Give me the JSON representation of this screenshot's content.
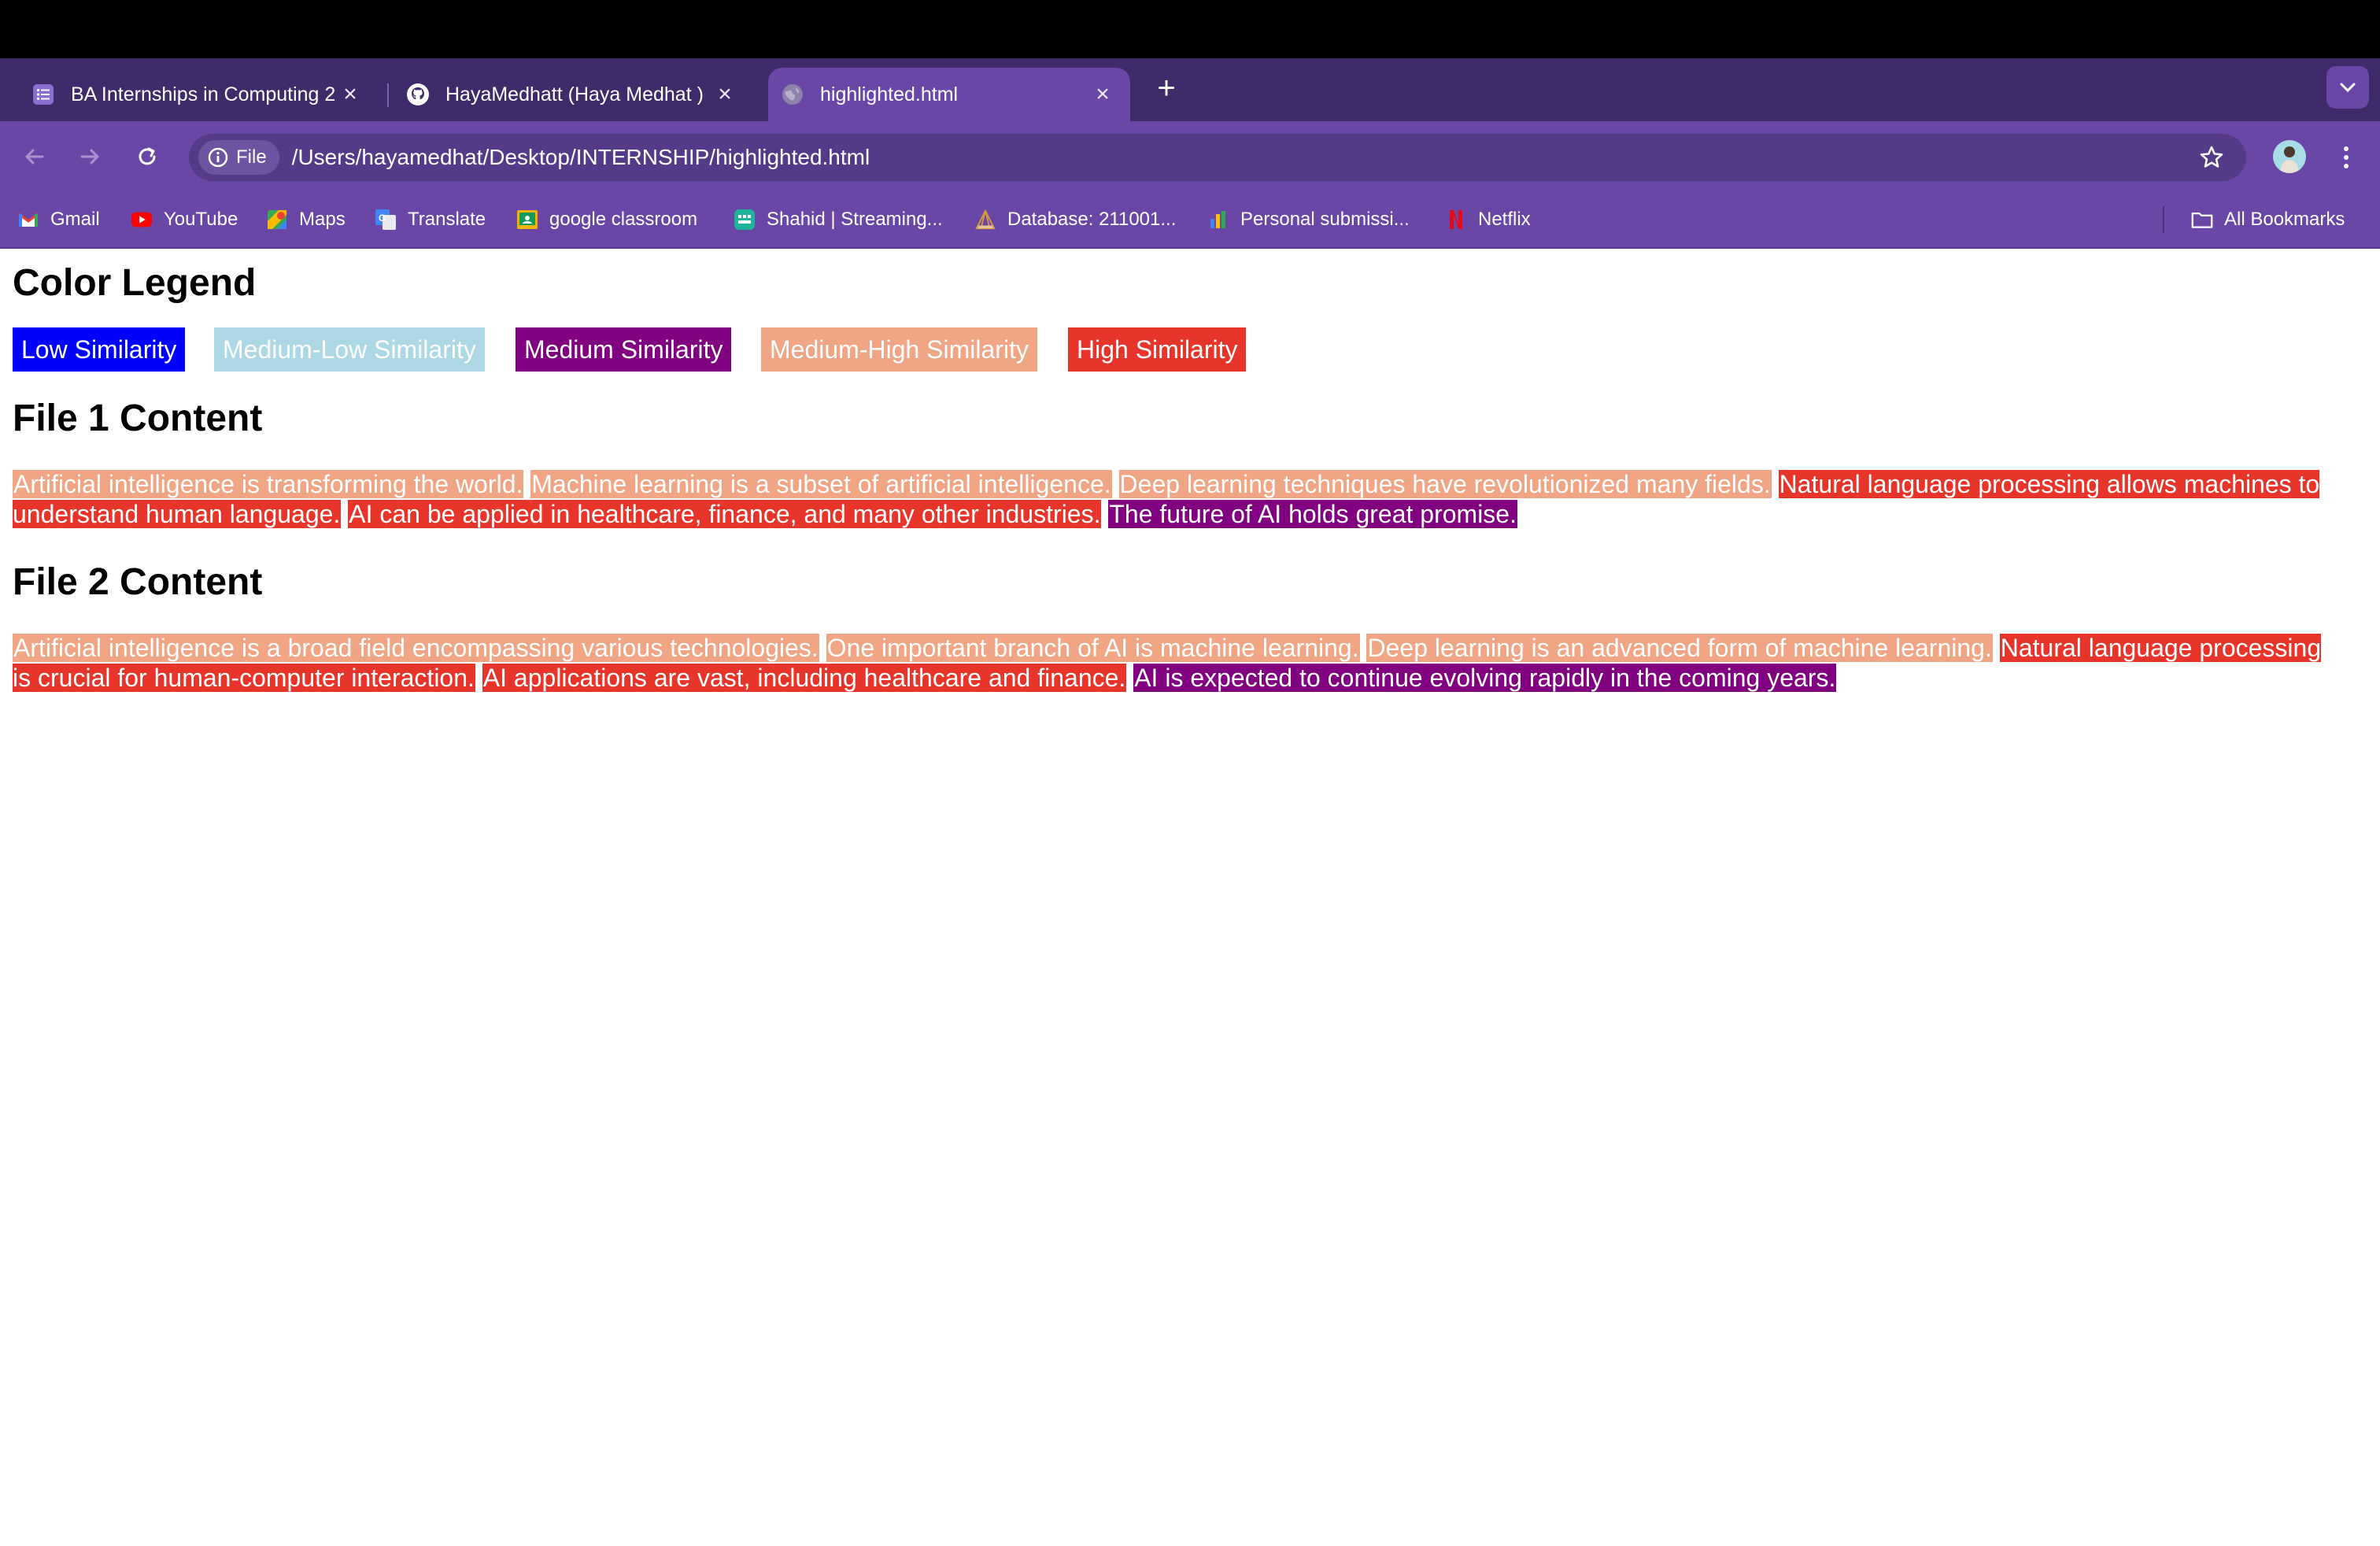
{
  "tabs": [
    {
      "title": "BA Internships in Computing 2",
      "icon": "list-icon",
      "active": false
    },
    {
      "title": "HayaMedhatt (Haya Medhat )",
      "icon": "github-icon",
      "active": false
    },
    {
      "title": "highlighted.html",
      "icon": "globe-icon",
      "active": true
    }
  ],
  "toolbar": {
    "site_chip": "File",
    "url": "/Users/hayamedhat/Desktop/INTERNSHIP/highlighted.html"
  },
  "bookmarks": [
    {
      "label": "Gmail",
      "icon": "gmail-icon"
    },
    {
      "label": "YouTube",
      "icon": "youtube-icon"
    },
    {
      "label": "Maps",
      "icon": "maps-icon"
    },
    {
      "label": "Translate",
      "icon": "translate-icon"
    },
    {
      "label": "google classroom",
      "icon": "classroom-icon"
    },
    {
      "label": "Shahid | Streaming...",
      "icon": "shahid-icon"
    },
    {
      "label": "Database: 211001...",
      "icon": "database-icon"
    },
    {
      "label": "Personal submissi...",
      "icon": "chart-icon"
    },
    {
      "label": "Netflix",
      "icon": "netflix-icon"
    }
  ],
  "all_bookmarks": "All Bookmarks",
  "page": {
    "legend_title": "Color Legend",
    "legend": [
      {
        "label": "Low Similarity",
        "color": "#0000ff"
      },
      {
        "label": "Medium-Low Similarity",
        "color": "#add8e6"
      },
      {
        "label": "Medium Similarity",
        "color": "#800080"
      },
      {
        "label": "Medium-High Similarity",
        "color": "#f0a585"
      },
      {
        "label": "High Similarity",
        "color": "#e8352b"
      }
    ],
    "file1_title": "File 1 Content",
    "file1_sentences": [
      {
        "text": "Artificial intelligence is transforming the world.",
        "level": "Medium-High Similarity"
      },
      {
        "text": "Machine learning is a subset of artificial intelligence.",
        "level": "Medium-High Similarity"
      },
      {
        "text": "Deep learning techniques have revolutionized many fields.",
        "level": "Medium-High Similarity"
      },
      {
        "text": "Natural language processing allows machines to understand human language.",
        "level": "High Similarity"
      },
      {
        "text": "AI can be applied in healthcare, finance, and many other industries.",
        "level": "High Similarity"
      },
      {
        "text": "The future of AI holds great promise.",
        "level": "Medium Similarity"
      }
    ],
    "file2_title": "File 2 Content",
    "file2_sentences": [
      {
        "text": "Artificial intelligence is a broad field encompassing various technologies.",
        "level": "Medium-High Similarity"
      },
      {
        "text": "One important branch of AI is machine learning.",
        "level": "Medium-High Similarity"
      },
      {
        "text": "Deep learning is an advanced form of machine learning.",
        "level": "Medium-High Similarity"
      },
      {
        "text": "Natural language processing is crucial for human-computer interaction.",
        "level": "High Similarity"
      },
      {
        "text": "AI applications are vast, including healthcare and finance.",
        "level": "High Similarity"
      },
      {
        "text": "AI is expected to continue evolving rapidly in the coming years.",
        "level": "Medium Similarity"
      }
    ]
  },
  "colors": {
    "tabstrip": "#3f2a6a",
    "toolbar": "#6a47a6",
    "omnibox": "#553a87"
  }
}
